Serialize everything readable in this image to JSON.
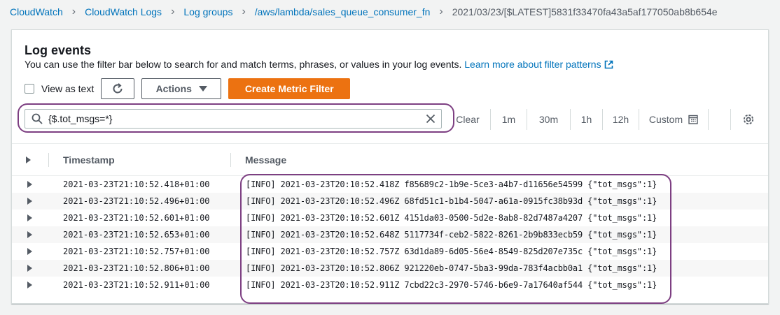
{
  "breadcrumb": {
    "items": [
      "CloudWatch",
      "CloudWatch Logs",
      "Log groups",
      "/aws/lambda/sales_queue_consumer_fn"
    ],
    "current": "2021/03/23/[$LATEST]5831f33470fa43a5af177050ab8b654e"
  },
  "panel": {
    "title": "Log events",
    "description": "You can use the filter bar below to search for and match terms, phrases, or values in your log events.",
    "learn_more": "Learn more about filter patterns"
  },
  "toolbar": {
    "view_as_text": "View as text",
    "actions_label": "Actions",
    "create_metric_filter": "Create Metric Filter"
  },
  "filter": {
    "value": "{$.tot_msgs=*}"
  },
  "time_range": {
    "clear": "Clear",
    "r1m": "1m",
    "r30m": "30m",
    "r1h": "1h",
    "r12h": "12h",
    "custom": "Custom"
  },
  "table": {
    "headers": {
      "timestamp": "Timestamp",
      "message": "Message"
    },
    "rows": [
      {
        "timestamp": "2021-03-23T21:10:52.418+01:00",
        "message": "[INFO] 2021-03-23T20:10:52.418Z f85689c2-1b9e-5ce3-a4b7-d11656e54599 {\"tot_msgs\":1}"
      },
      {
        "timestamp": "2021-03-23T21:10:52.496+01:00",
        "message": "[INFO] 2021-03-23T20:10:52.496Z 68fd51c1-b1b4-5047-a61a-0915fc38b93d {\"tot_msgs\":1}"
      },
      {
        "timestamp": "2021-03-23T21:10:52.601+01:00",
        "message": "[INFO] 2021-03-23T20:10:52.601Z 4151da03-0500-5d2e-8ab8-82d7487a4207 {\"tot_msgs\":1}"
      },
      {
        "timestamp": "2021-03-23T21:10:52.653+01:00",
        "message": "[INFO] 2021-03-23T20:10:52.648Z 5117734f-ceb2-5822-8261-2b9b833ecb59 {\"tot_msgs\":1}"
      },
      {
        "timestamp": "2021-03-23T21:10:52.757+01:00",
        "message": "[INFO] 2021-03-23T20:10:52.757Z 63d1da89-6d05-56e4-8549-825d207e735c {\"tot_msgs\":1}"
      },
      {
        "timestamp": "2021-03-23T21:10:52.806+01:00",
        "message": "[INFO] 2021-03-23T20:10:52.806Z 921220eb-0747-5ba3-99da-783f4acbb0a1 {\"tot_msgs\":1}"
      },
      {
        "timestamp": "2021-03-23T21:10:52.911+01:00",
        "message": "[INFO] 2021-03-23T20:10:52.911Z 7cbd22c3-2970-5746-b6e9-7a17640af544 {\"tot_msgs\":1}"
      }
    ]
  },
  "colors": {
    "link": "#0073bb",
    "primary": "#ec7211",
    "annotation": "#7d3f82"
  }
}
